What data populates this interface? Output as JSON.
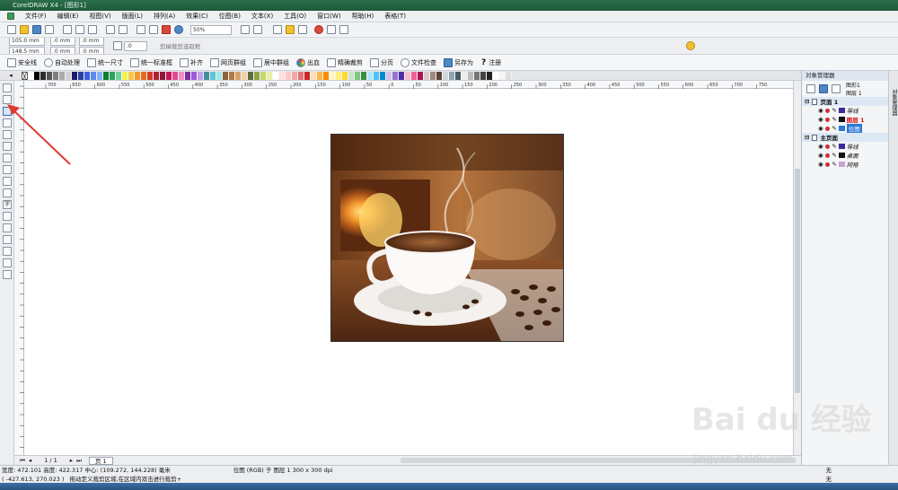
{
  "window": {
    "title": "CorelDRAW X4 - [图形1]"
  },
  "menu": [
    "文件(F)",
    "编辑(E)",
    "视图(V)",
    "版面(L)",
    "排列(A)",
    "效果(C)",
    "位图(B)",
    "文本(X)",
    "工具(O)",
    "窗口(W)",
    "帮助(H)",
    "表格(T)"
  ],
  "toolbar": {
    "zoom": "50%"
  },
  "property_bar": {
    "width": "105.0 mm",
    "height": "148.5 mm",
    "x": ".0 mm",
    "y": ".0 mm",
    "x2": ".0 mm",
    "y2": ".0 mm",
    "angle": ".0",
    "hint": "剪掉裁剪选取框"
  },
  "command_bar": [
    "安全线",
    "自动处理",
    "统一尺寸",
    "统一标准框",
    "补齐",
    "网页群组",
    "居中群组",
    "出血",
    "精确裁剪",
    "分页",
    "文件检查",
    "另存为",
    "注册"
  ],
  "ruler": {
    "ticks": [
      "700",
      "650",
      "600",
      "550",
      "500",
      "450",
      "400",
      "350",
      "300",
      "250",
      "200",
      "150",
      "100",
      "50",
      "0",
      "50",
      "100",
      "150",
      "200",
      "250",
      "300",
      "350",
      "400",
      "450",
      "500",
      "550",
      "600",
      "650",
      "700",
      "750"
    ]
  },
  "palette_colors": [
    "#ffffff",
    "#000000",
    "#2b2b2b",
    "#555555",
    "#7f7f7f",
    "#aaaaaa",
    "#d4d4d4",
    "#1a1a6e",
    "#283ea3",
    "#3b5fd8",
    "#5a8cf0",
    "#84b0f7",
    "#0b7c34",
    "#2aa45a",
    "#6fd19a",
    "#f2f24a",
    "#f7c948",
    "#f29b2b",
    "#e46a1f",
    "#d33b26",
    "#b21f2d",
    "#8e1539",
    "#c2185b",
    "#e24a8c",
    "#f28ec2",
    "#7b2fa3",
    "#9c5ad8",
    "#c4a0f0",
    "#3e8e9e",
    "#63c4d3",
    "#a0e7ef",
    "#8c6239",
    "#b07a47",
    "#d7a468",
    "#f0d2a6",
    "#5f6b3a",
    "#8da34a",
    "#c5d66b",
    "#e7f0a6",
    "#ffffff",
    "#ffe0e0",
    "#ffc8c8",
    "#f4a6a6",
    "#e57373",
    "#c62828",
    "#ffe0b2",
    "#ffb74d",
    "#fb8c00",
    "#fff9c4",
    "#fff176",
    "#fdd835",
    "#c8e6c9",
    "#81c784",
    "#388e3c",
    "#b3e5fc",
    "#4fc3f7",
    "#0288d1",
    "#d1c4e9",
    "#9575cd",
    "#512da8",
    "#f8bbd0",
    "#f06292",
    "#ad1457",
    "#d7ccc8",
    "#a1887f",
    "#5d4037",
    "#cfd8dc",
    "#90a4ae",
    "#455a64",
    "#eeeeee",
    "#bdbdbd",
    "#757575",
    "#424242",
    "#212121",
    "#ffffff",
    "#f5f5f5",
    "#e0e0e0"
  ],
  "toolbox": [
    "pick-tool",
    "shape-tool",
    "crop-tool",
    "zoom-tool",
    "freehand-tool",
    "smart-fill-tool",
    "rectangle-tool",
    "ellipse-tool",
    "polygon-tool",
    "basic-shapes-tool",
    "text-tool",
    "table-tool",
    "interactive-tool",
    "eyedropper-tool",
    "outline-tool",
    "fill-tool",
    "interactive-fill-tool"
  ],
  "object_manager": {
    "title": "对象管理器",
    "page_label": "图形1",
    "layer_label": "图层 1",
    "groups": [
      {
        "name": "页面 1",
        "rows": [
          {
            "label": "导线",
            "color": "#3a2a9a"
          },
          {
            "label": "图层 1",
            "color": "#111111",
            "highlight": true
          },
          {
            "label": "位图",
            "color": "#2f78d6",
            "selected": true
          }
        ]
      },
      {
        "name": "主页面",
        "rows": [
          {
            "label": "导线",
            "color": "#3a2a9a"
          },
          {
            "label": "桌面",
            "color": "#111111"
          },
          {
            "label": "网格",
            "color": "#c9a3d2"
          }
        ]
      }
    ]
  },
  "page_nav": {
    "current": "1 / 1",
    "tab": "页 1"
  },
  "status": {
    "line1": "宽度: 472.101 高度: 422.317 中心: (109.272, 144.228) 毫米",
    "info": "位图 (RGB) 于 图层 1 300 x 300 dpi",
    "line2": "( -427.613, 270.023 )",
    "hint": "拖动定义裁剪区域;在区域内双击进行裁剪+",
    "fill": "无",
    "outline": "无"
  },
  "watermark": {
    "brand": "Bai du 经验",
    "url": "jingyan.baidu.com"
  }
}
